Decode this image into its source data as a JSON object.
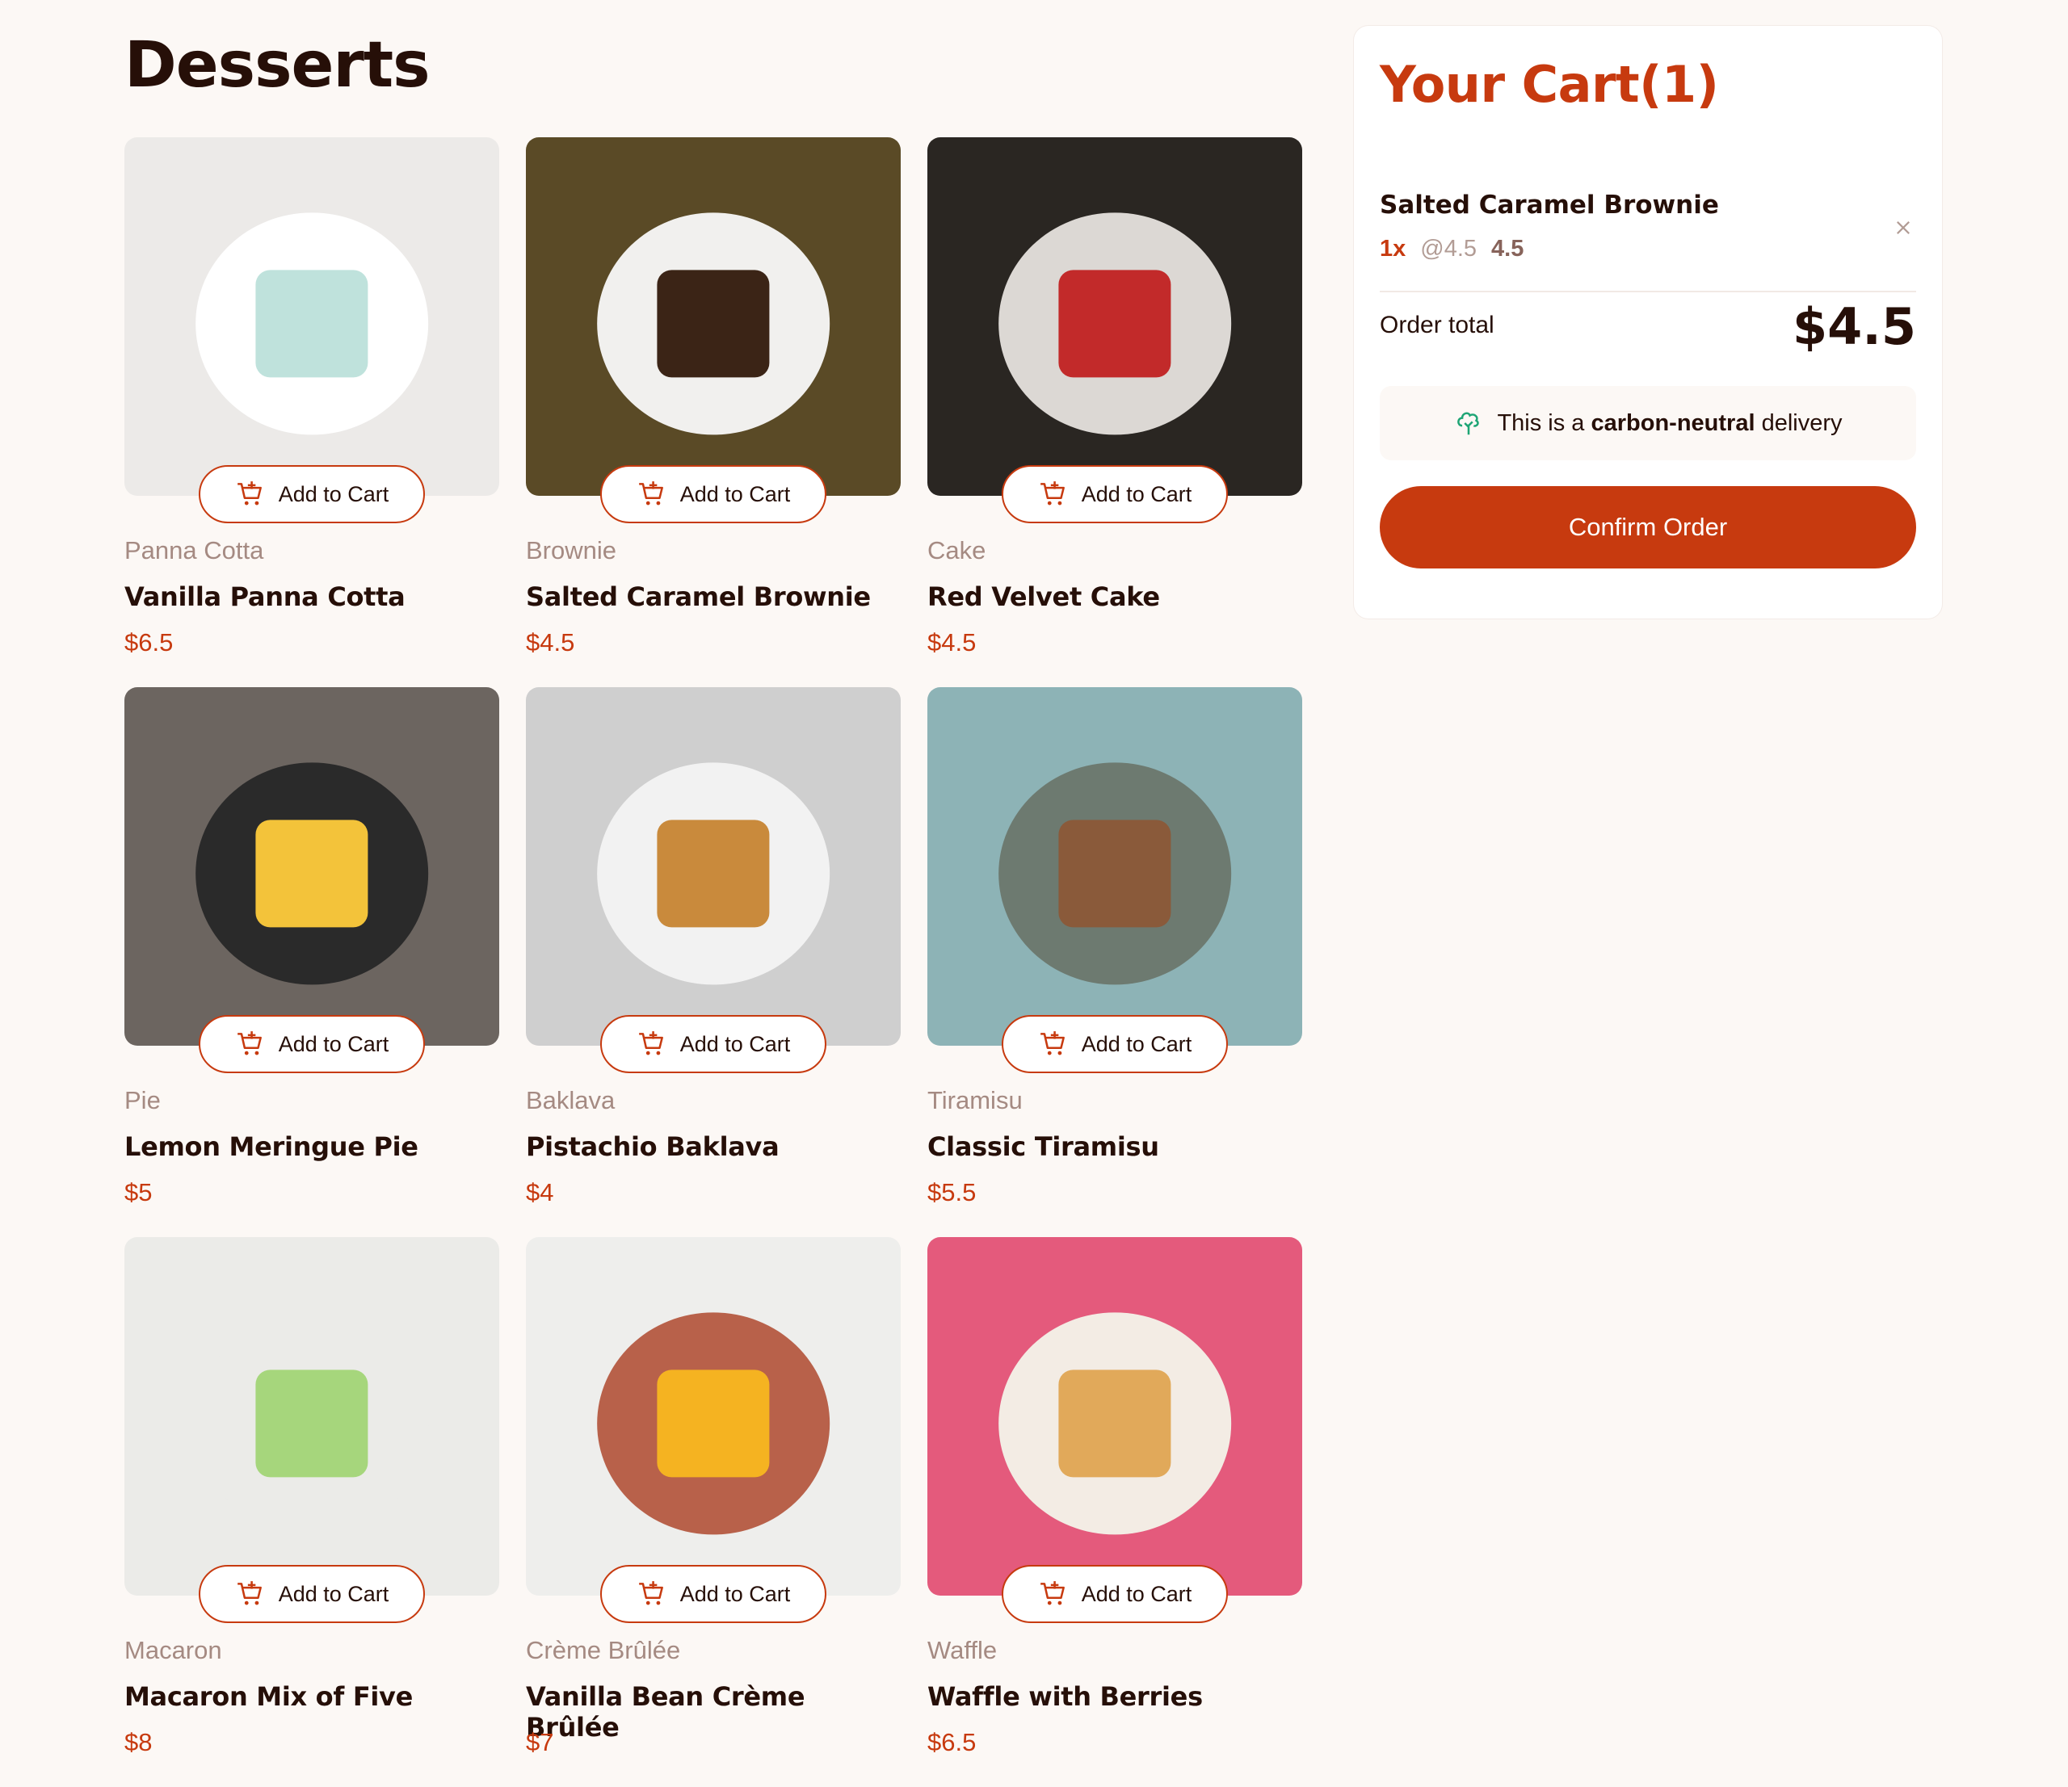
{
  "page": {
    "title": "Desserts"
  },
  "add_to_cart_label": "Add to Cart",
  "products": [
    {
      "category": "Panna Cotta",
      "name": "Vanilla Panna Cotta",
      "price": "$6.5",
      "bg": "#eceae8",
      "plate": "#ffffff",
      "food": "#bfe2dc"
    },
    {
      "category": "Brownie",
      "name": "Salted Caramel Brownie",
      "price": "$4.5",
      "bg": "#5a4a26",
      "plate": "#f1f0ee",
      "food": "#3b2416"
    },
    {
      "category": "Cake",
      "name": "Red Velvet Cake",
      "price": "$4.5",
      "bg": "#2a2622",
      "plate": "#dcd8d4",
      "food": "#c22a2a"
    },
    {
      "category": "Pie",
      "name": "Lemon Meringue Pie",
      "price": "$5",
      "bg": "#6c6560",
      "plate": "#2a2a2a",
      "food": "#f3c33a"
    },
    {
      "category": "Baklava",
      "name": "Pistachio Baklava",
      "price": "$4",
      "bg": "#cfcfcf",
      "plate": "#f2f2f2",
      "food": "#c98a3c"
    },
    {
      "category": "Tiramisu",
      "name": "Classic Tiramisu",
      "price": "$5.5",
      "bg": "#8db3b6",
      "plate": "#6d7a70",
      "food": "#8a5a3a"
    },
    {
      "category": "Macaron",
      "name": "Macaron Mix of Five",
      "price": "$8",
      "bg": "#ebebe8",
      "plate": "#ebebe8",
      "food": "#a6d67c"
    },
    {
      "category": "Crème Brûlée",
      "name": "Vanilla Bean Crème Brûlée",
      "price": "$7",
      "bg": "#eeeeec",
      "plate": "#b8614a",
      "food": "#f5b321"
    },
    {
      "category": "Waffle",
      "name": "Waffle with Berries",
      "price": "$6.5",
      "bg": "#e45a7c",
      "plate": "#f3ece4",
      "food": "#e1a95a"
    }
  ],
  "cart": {
    "title": "Your Cart(1)",
    "items": [
      {
        "name": "Salted Caramel Brownie",
        "qty": "1x",
        "unit": "@4.5",
        "total": "4.5"
      }
    ],
    "order_total_label": "Order total",
    "order_total_value": "$4.5",
    "carbon_prefix": "This is a",
    "carbon_bold": "carbon-neutral",
    "carbon_suffix": "delivery",
    "confirm_label": "Confirm Order"
  },
  "colors": {
    "accent": "#c73a0f",
    "text": "#260f08",
    "muted": "#a58a82",
    "carbon_icon": "#1ea575"
  }
}
